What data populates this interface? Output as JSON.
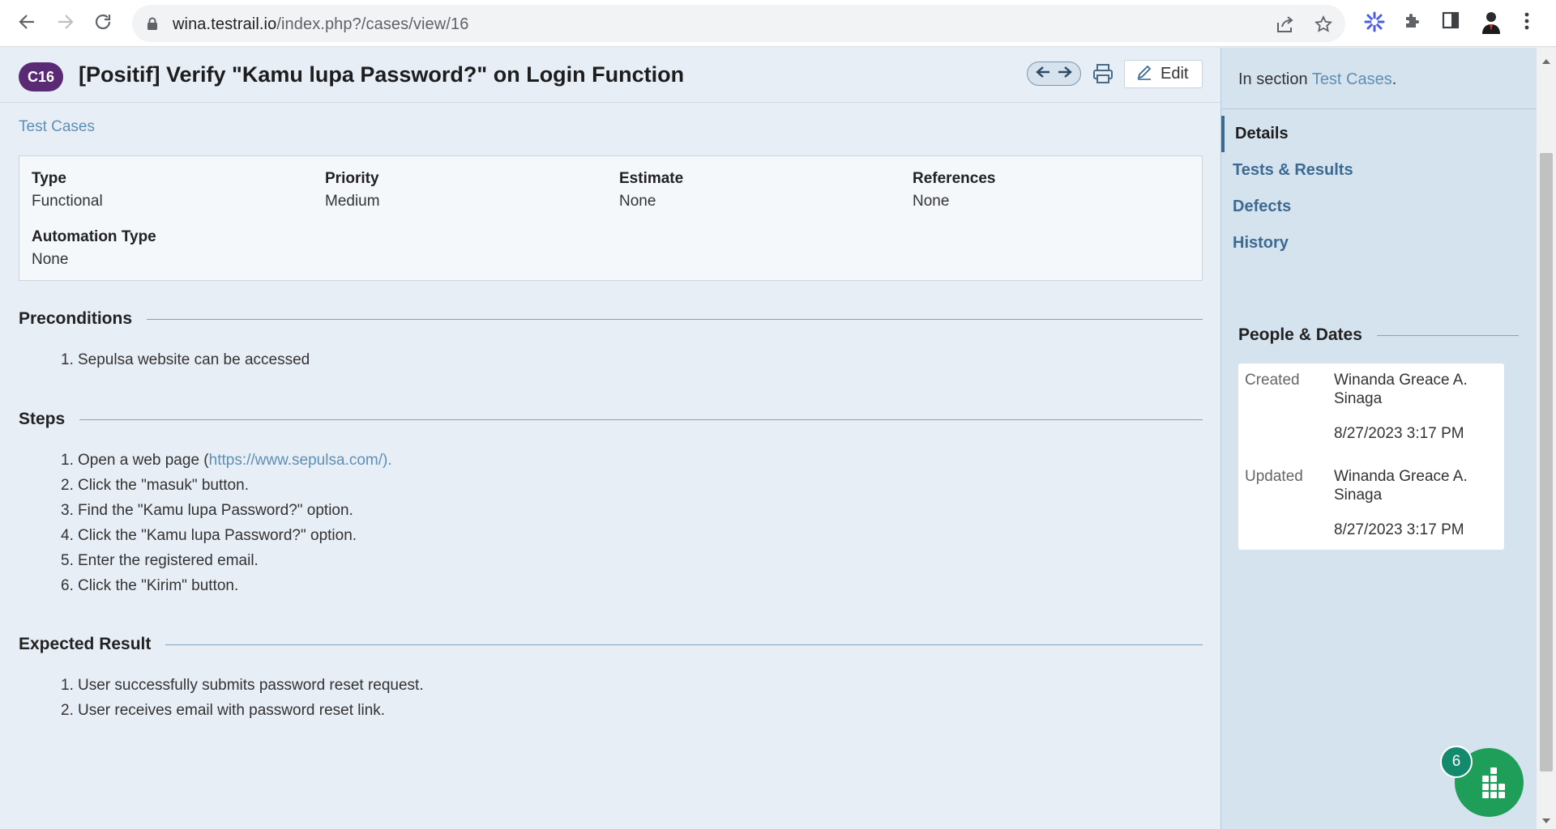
{
  "browser": {
    "url_host": "wina.testrail.io",
    "url_path": "/index.php?/cases/view/16"
  },
  "case": {
    "id": "C16",
    "title": "[Positif] Verify \"Kamu lupa Password?\" on Login Function",
    "edit_label": "Edit",
    "breadcrumb": "Test Cases"
  },
  "fields": {
    "type_label": "Type",
    "type_value": "Functional",
    "priority_label": "Priority",
    "priority_value": "Medium",
    "estimate_label": "Estimate",
    "estimate_value": "None",
    "references_label": "References",
    "references_value": "None",
    "automation_label": "Automation Type",
    "automation_value": "None"
  },
  "preconditions": {
    "heading": "Preconditions",
    "items": [
      "Sepulsa website can be accessed"
    ]
  },
  "steps": {
    "heading": "Steps",
    "item1_prefix": "Open a web page (",
    "item1_link": "https://www.sepulsa.com/).",
    "items": [
      "Click the \"masuk\" button.",
      "Find the \"Kamu lupa Password?\" option.",
      "Click the \"Kamu lupa Password?\" option.",
      "Enter the registered email.",
      "Click the \"Kirim\" button."
    ]
  },
  "expected": {
    "heading": "Expected Result",
    "items": [
      "User successfully submits password reset request.",
      "User receives email with password reset link."
    ]
  },
  "sidebar": {
    "section_prefix": "In section ",
    "section_link": "Test Cases",
    "section_suffix": ".",
    "nav": [
      "Details",
      "Tests & Results",
      "Defects",
      "History"
    ],
    "people_heading": "People & Dates",
    "created_label": "Created",
    "created_name_1": "Winanda Greace A.",
    "created_name_2": "Sinaga",
    "created_date": "8/27/2023 3:17 PM",
    "updated_label": "Updated",
    "updated_name_1": "Winanda Greace A.",
    "updated_name_2": "Sinaga",
    "updated_date": "8/27/2023 3:17 PM"
  },
  "widget": {
    "badge": "6"
  },
  "colors": {
    "accent": "#5a2b74",
    "link": "#5e8fb5",
    "widget": "#1f9e5a"
  }
}
